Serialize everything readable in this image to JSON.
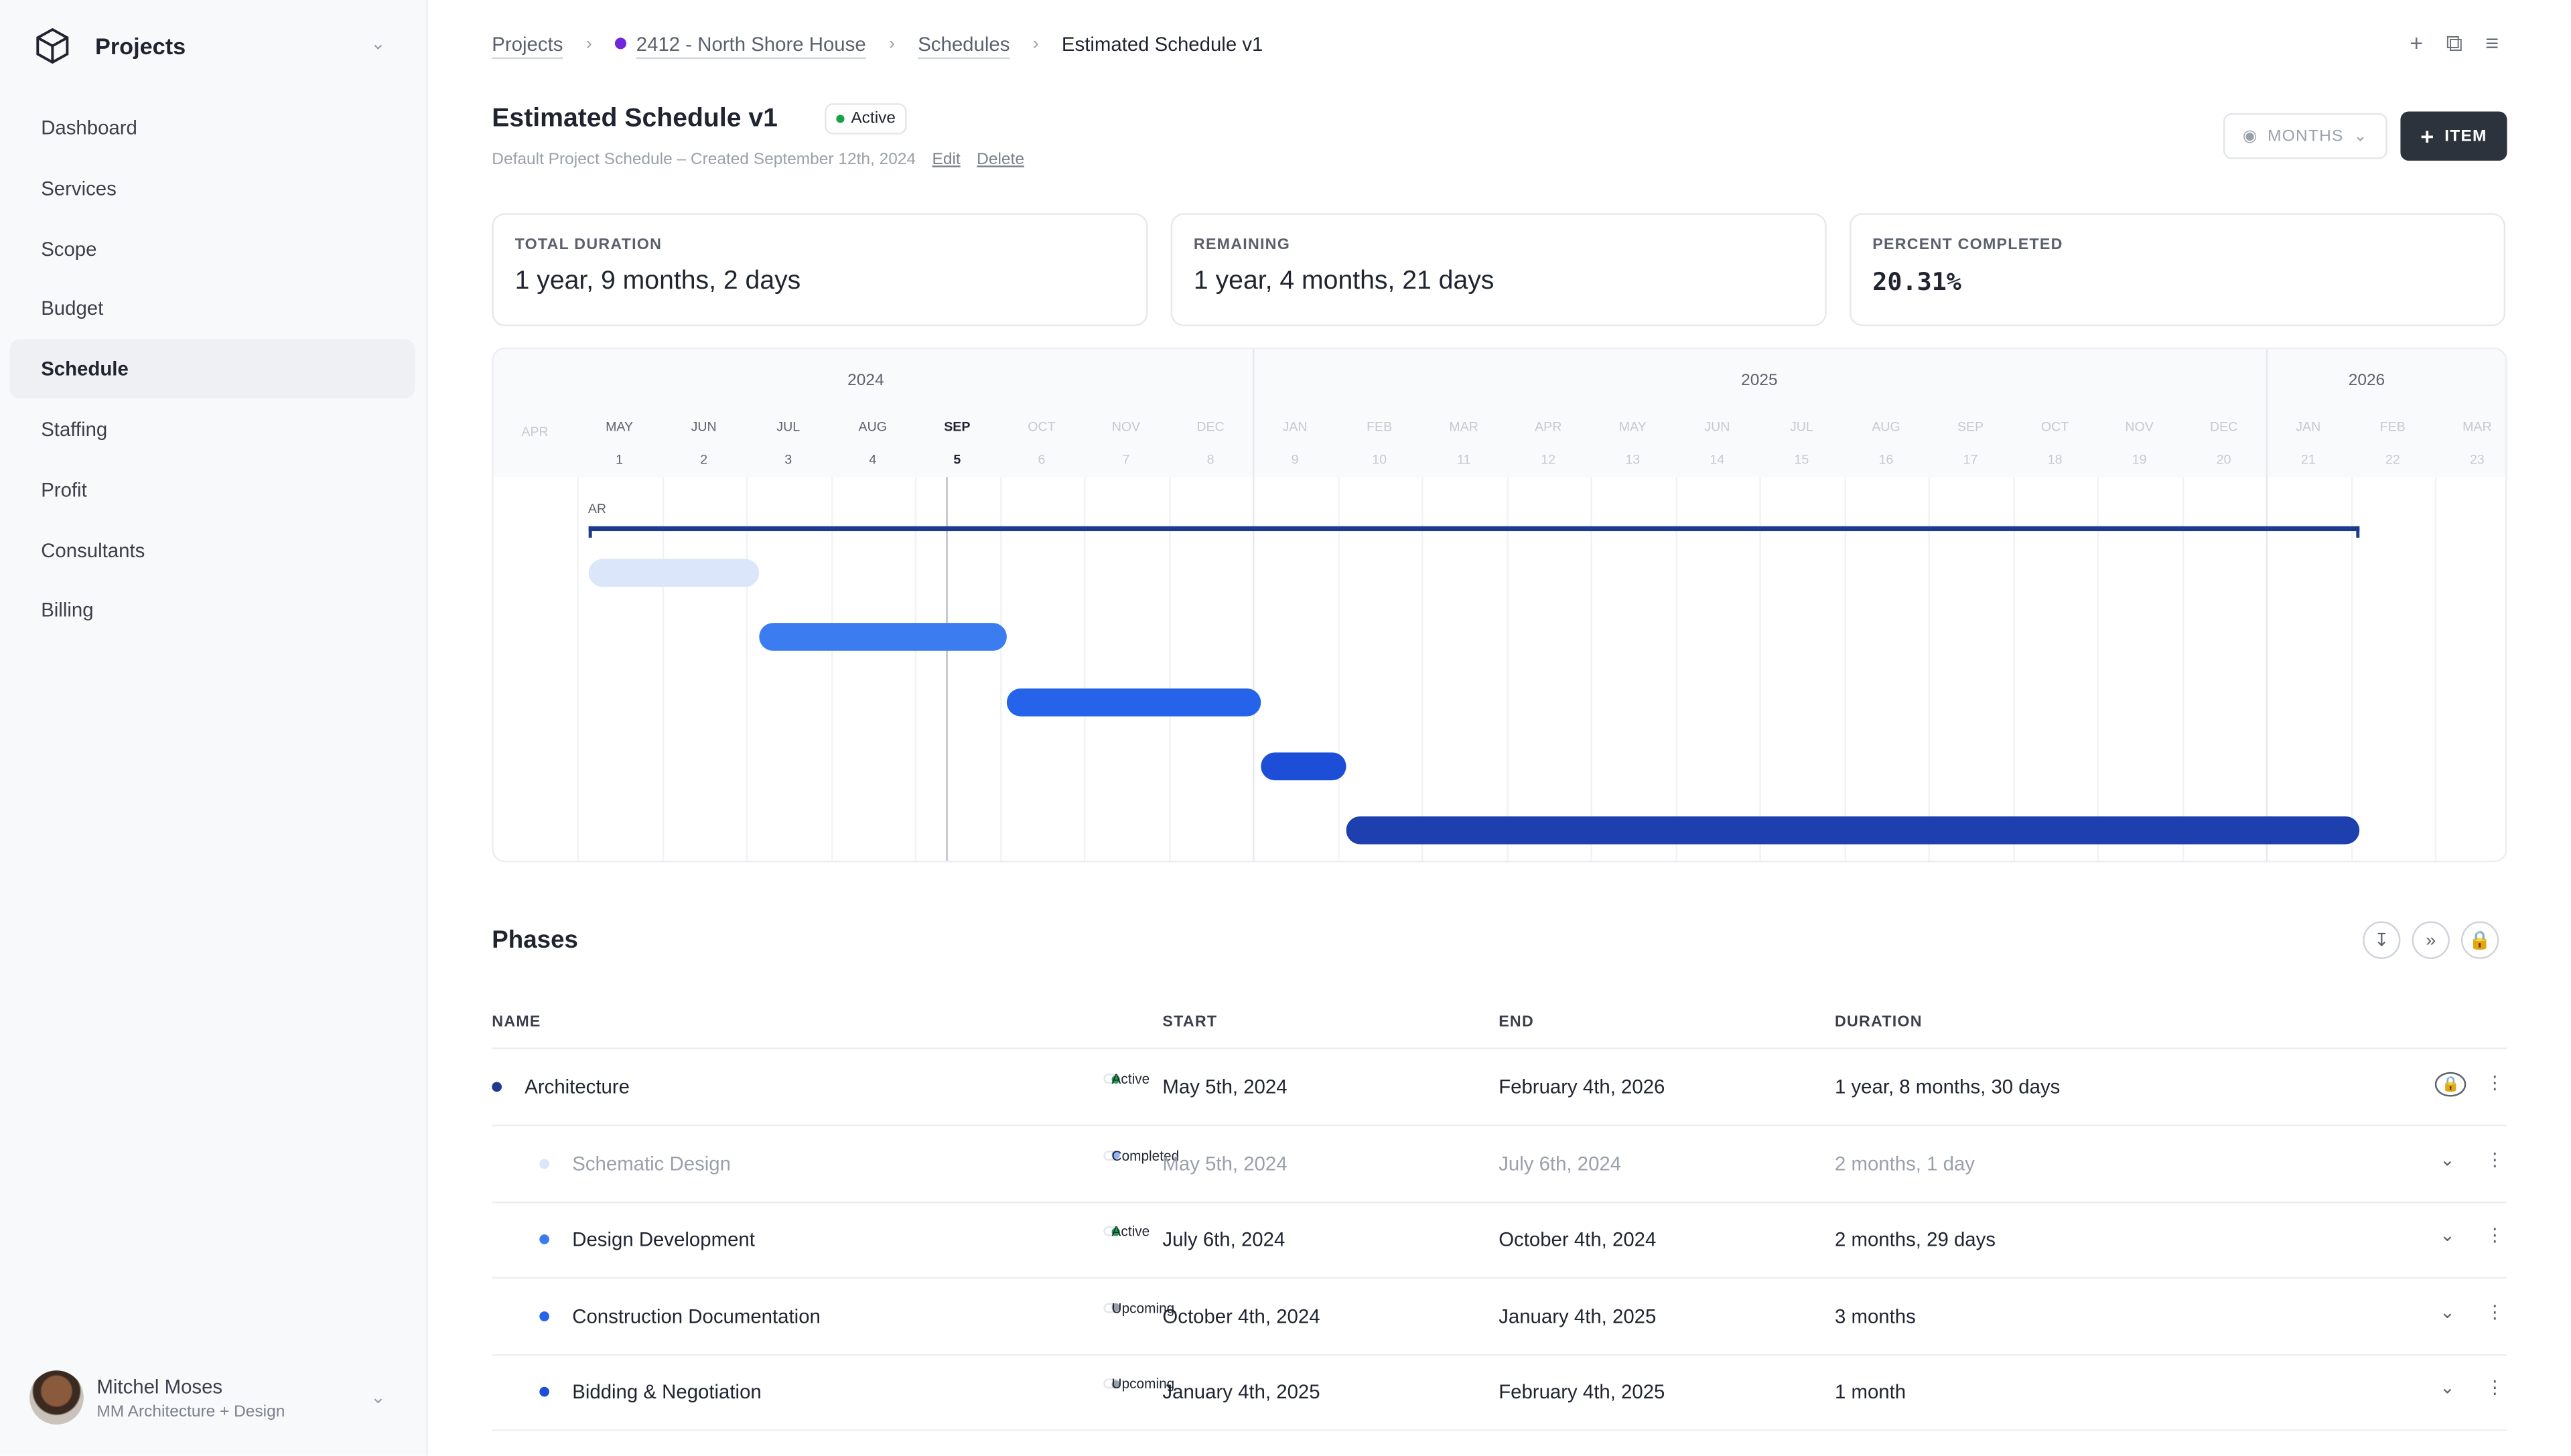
{
  "sidebar": {
    "brand": "Projects",
    "items": [
      {
        "label": "Dashboard"
      },
      {
        "label": "Services"
      },
      {
        "label": "Scope"
      },
      {
        "label": "Budget"
      },
      {
        "label": "Schedule",
        "active": true
      },
      {
        "label": "Staffing"
      },
      {
        "label": "Profit"
      },
      {
        "label": "Consultants"
      },
      {
        "label": "Billing"
      }
    ],
    "user": {
      "name": "Mitchel Moses",
      "org": "MM Architecture + Design"
    }
  },
  "breadcrumb": [
    {
      "label": "Projects"
    },
    {
      "label": "2412 - North Shore House",
      "dot_color": "#6d28d9"
    },
    {
      "label": "Schedules"
    },
    {
      "label": "Estimated Schedule v1"
    }
  ],
  "header": {
    "title": "Estimated Schedule v1",
    "status": "Active",
    "subtitle": "Default Project Schedule – Created September 12th, 2024",
    "edit": "Edit",
    "delete": "Delete",
    "view_select": "MONTHS",
    "add_item": "ITEM"
  },
  "stats": [
    {
      "label": "TOTAL DURATION",
      "value": "1 year, 9 months, 2 days"
    },
    {
      "label": "REMAINING",
      "value": "1 year, 4 months, 21 days"
    },
    {
      "label": "PERCENT COMPLETED",
      "value": "20.31%"
    }
  ],
  "gantt": {
    "years": [
      "2024",
      "2025",
      "2026"
    ],
    "months": [
      "APR",
      "MAY",
      "JUN",
      "JUL",
      "AUG",
      "SEP",
      "OCT",
      "NOV",
      "DEC",
      "JAN",
      "FEB",
      "MAR",
      "APR",
      "MAY",
      "JUN",
      "JUL",
      "AUG",
      "SEP",
      "OCT",
      "NOV",
      "DEC",
      "JAN",
      "FEB",
      "MAR"
    ],
    "month_numbers": [
      "",
      "1",
      "2",
      "3",
      "4",
      "5",
      "6",
      "7",
      "8",
      "9",
      "10",
      "11",
      "12",
      "13",
      "14",
      "15",
      "16",
      "17",
      "18",
      "19",
      "20",
      "21",
      "22",
      "23"
    ],
    "today": "2024-09-12",
    "phase_bracket": {
      "label": "AR",
      "start": "2024-05-05",
      "end": "2026-02-04"
    },
    "bars": [
      {
        "start": "2024-05-05",
        "end": "2024-07-06",
        "color": "#dbe6fb"
      },
      {
        "start": "2024-07-06",
        "end": "2024-10-04",
        "color": "#3b7cf0"
      },
      {
        "start": "2024-10-04",
        "end": "2025-01-04",
        "color": "#2563eb"
      },
      {
        "start": "2025-01-04",
        "end": "2025-02-04",
        "color": "#1d4ed8"
      },
      {
        "start": "2025-02-04",
        "end": "2026-02-04",
        "color": "#1e40af"
      }
    ],
    "colors": {
      "status_active": "#16a34a",
      "status_upcoming": "#9aa0ab",
      "status_completed": "#93b4f5"
    }
  },
  "phases": {
    "title": "Phases",
    "columns": [
      "NAME",
      "START",
      "END",
      "DURATION"
    ],
    "rows": [
      {
        "name": "Architecture",
        "status": "Active",
        "start": "May 5th, 2024",
        "end": "February 4th, 2026",
        "duration": "1 year, 8 months, 30 days",
        "dot": "#1e3a8a",
        "level": 0
      },
      {
        "name": "Schematic Design",
        "status": "Completed",
        "start": "May 5th, 2024",
        "end": "July 6th, 2024",
        "duration": "2 months, 1 day",
        "dot": "#dbe6fb",
        "level": 1,
        "muted": true
      },
      {
        "name": "Design Development",
        "status": "Active",
        "start": "July 6th, 2024",
        "end": "October 4th, 2024",
        "duration": "2 months, 29 days",
        "dot": "#3b7cf0",
        "level": 1
      },
      {
        "name": "Construction Documentation",
        "status": "Upcoming",
        "start": "October 4th, 2024",
        "end": "January 4th, 2025",
        "duration": "3 months",
        "dot": "#2563eb",
        "level": 1
      },
      {
        "name": "Bidding & Negotiation",
        "status": "Upcoming",
        "start": "January 4th, 2025",
        "end": "February 4th, 2025",
        "duration": "1 month",
        "dot": "#1d4ed8",
        "level": 1
      }
    ]
  }
}
